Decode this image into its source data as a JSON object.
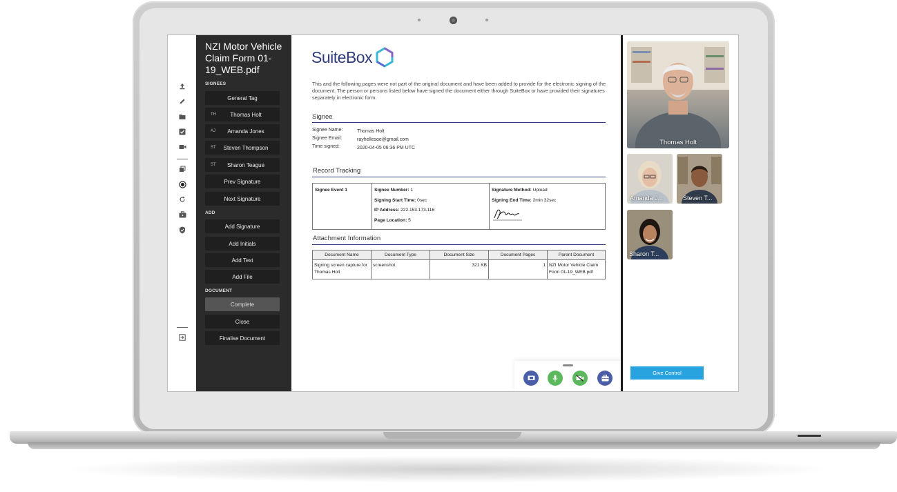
{
  "document": {
    "title": "NZI Motor Vehicle Claim Form 01-19_WEB.pdf",
    "brand": "SuiteBox",
    "intro": "This and the following pages were not part of the original document and have been added to provide for the electronic signing of the document. The person or persons listed below have signed the document either through SuiteBox or have provided their signatures separately in electronic form."
  },
  "panel": {
    "sections": {
      "signees": "SIGNEES",
      "add": "ADD",
      "document": "DOCUMENT"
    },
    "general_tag": "General Tag",
    "signees": [
      {
        "initials": "TH",
        "name": "Thomas Holt"
      },
      {
        "initials": "AJ",
        "name": "Amanda Jones"
      },
      {
        "initials": "ST",
        "name": "Steven Thompson"
      },
      {
        "initials": "ST",
        "name": "Sharon Teague"
      }
    ],
    "prev_signature": "Prev Signature",
    "next_signature": "Next Signature",
    "add_signature": "Add Signature",
    "add_initials": "Add Initials",
    "add_text": "Add Text",
    "add_file": "Add File",
    "complete": "Complete",
    "close": "Close",
    "finalise": "Finalise Document"
  },
  "signee": {
    "heading": "Signee",
    "name_label": "Signee Name:",
    "name": "Thomas Holt",
    "email_label": "Signee Email:",
    "email": "rayhellesoe@gmail.com",
    "time_label": "Time signed:",
    "time": "2020-04-05 06:36 PM UTC"
  },
  "record": {
    "heading": "Record Tracking",
    "event": "Signee Event 1",
    "number_label": "Signee Number:",
    "number": "1",
    "start_label": "Signing Start Time:",
    "start": "0sec",
    "ip_label": "IP Address:",
    "ip": "222.153.173.116",
    "page_label": "Page Location:",
    "page": "5",
    "method_label": "Signature Method:",
    "method": "Upload",
    "end_label": "Signing End Time:",
    "end": "2min 32sec"
  },
  "attachment": {
    "heading": "Attachment Information",
    "headers": [
      "Document Name",
      "Document Type",
      "Document Size",
      "Document Pages",
      "Parent Document"
    ],
    "row": [
      "Signing screen capture for Thomas Holt",
      "screenshot",
      "321 KB",
      "1",
      "NZI Motor Vehicle Claim Form 01-19_WEB.pdf"
    ]
  },
  "video": {
    "participants": [
      "Thomas Holt",
      "Amanda J...",
      "Steven T...",
      "Sharon T..."
    ],
    "give_control": "Give Control"
  },
  "colors": {
    "brand": "#2e3a7a",
    "panel": "#2b2b2b",
    "accent": "#29a3e0",
    "mic": "#5cb85c",
    "control": "#4a5fa8"
  },
  "icons": {
    "rail": [
      "upload-icon",
      "pen-icon",
      "folder-icon",
      "checkbox-icon",
      "video-icon",
      "copy-icon",
      "record-icon",
      "refresh-icon",
      "briefcase-icon",
      "shield-icon",
      "exit-icon"
    ],
    "controls": [
      "screen-share-icon",
      "microphone-icon",
      "camera-off-icon",
      "briefcase-icon"
    ]
  }
}
